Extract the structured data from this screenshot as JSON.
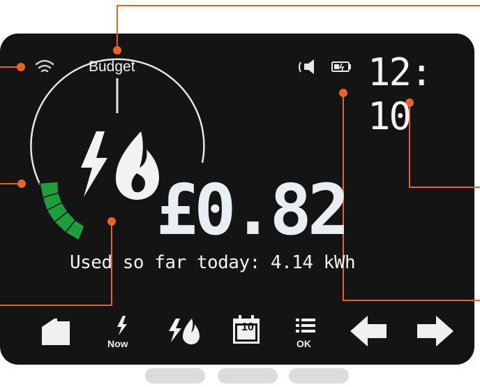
{
  "header": {
    "budget_label": "Budget",
    "time": "12: 10"
  },
  "main": {
    "cost": "£0.82",
    "usage_text": "Used so far today: 4.14 kWh"
  },
  "gauge": {
    "lit_segments": 4,
    "segment_color": "#1e9e3a"
  },
  "toolbar": {
    "now_label": "Now",
    "calendar_day": "10",
    "ok_label": "OK",
    "icons": [
      "home-icon",
      "electricity-now-icon",
      "electricity-gas-icon",
      "calendar-icon",
      "menu-list-icon",
      "arrow-left-icon",
      "arrow-right-icon"
    ]
  },
  "status_icons": [
    "wifi-icon",
    "speaker-icon",
    "battery-icon"
  ],
  "colors": {
    "screen": "#121212",
    "bezel": "#d9d9d9",
    "callout": "#e8622c",
    "text": "#f2f2f2"
  }
}
